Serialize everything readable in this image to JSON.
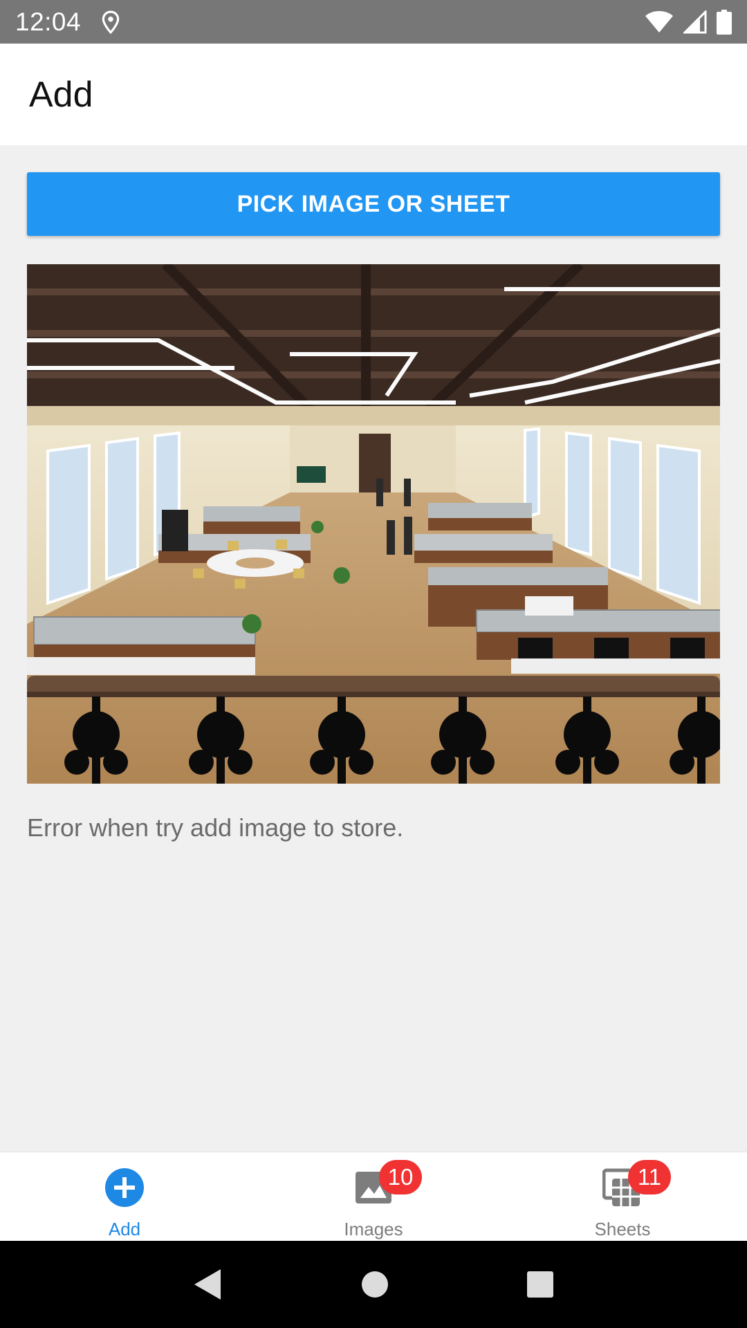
{
  "status_bar": {
    "time": "12:04",
    "icons": [
      "location-icon",
      "wifi-icon",
      "signal-icon",
      "battery-icon"
    ]
  },
  "header": {
    "title": "Add"
  },
  "main": {
    "pick_button_label": "PICK IMAGE OR SHEET",
    "preview_image": "office-hall-photo",
    "error_message": "Error when try add image to store."
  },
  "bottom_nav": {
    "items": [
      {
        "label": "Add",
        "icon": "add-circle-icon",
        "active": true
      },
      {
        "label": "Images",
        "icon": "image-icon",
        "badge": "10"
      },
      {
        "label": "Sheets",
        "icon": "sheets-icon",
        "badge": "11"
      }
    ]
  },
  "system_nav": {
    "icons": [
      "back-icon",
      "home-icon",
      "recents-icon"
    ]
  },
  "colors": {
    "accent": "#2196f3",
    "active_tab": "#1e88e5",
    "badge": "#f03232",
    "status_bar": "#777777"
  }
}
